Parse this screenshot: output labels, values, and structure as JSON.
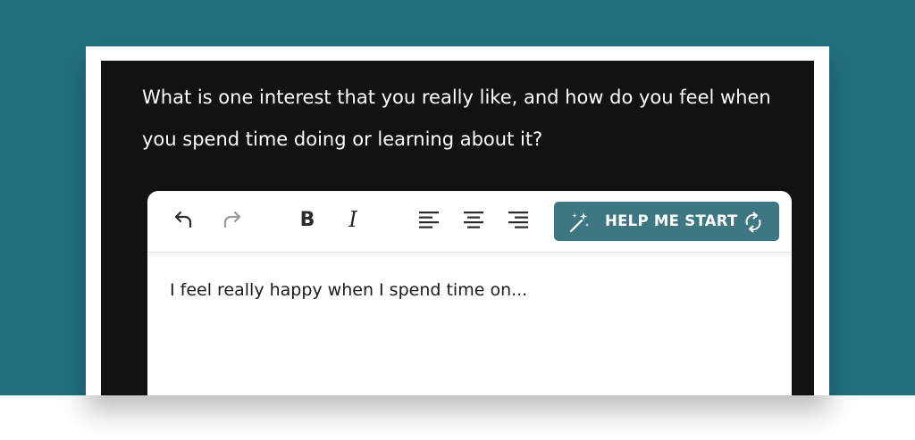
{
  "prompt": {
    "question": "What is one interest that you really like, and how do you feel when you spend time doing or learning about it?"
  },
  "editor": {
    "toolbar": {
      "undo_icon": "undo-icon",
      "redo_icon": "redo-icon",
      "bold_glyph": "B",
      "italic_glyph": "I",
      "align_icons": [
        "align-left-icon",
        "align-center-icon",
        "align-right-icon"
      ],
      "help_button": {
        "label": "HELP ME START",
        "icon_left": "magic-wand-icon",
        "icon_right": "refresh-icon"
      }
    },
    "content_text": "I feel really happy when I spend time on..."
  },
  "colors": {
    "background_teal": "#21707f",
    "panel_dark": "#121212",
    "help_button_bg": "#3d7782",
    "redo_disabled": "#9a9a9a"
  }
}
